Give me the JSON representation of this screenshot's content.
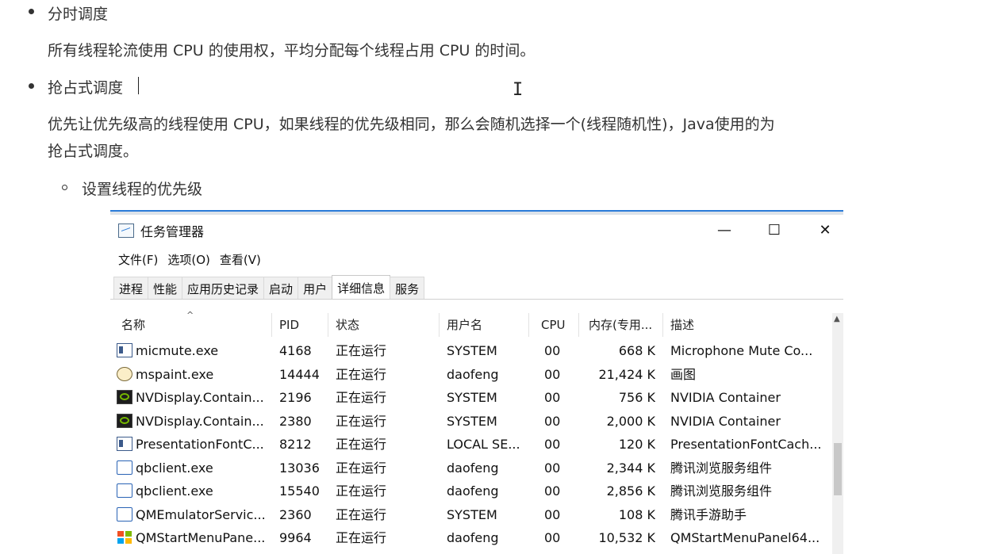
{
  "doc": {
    "bullet1_title": "分时调度",
    "bullet1_body": "所有线程轮流使用 CPU 的使用权，平均分配每个线程占用 CPU 的时间。",
    "bullet2_title": "抢占式调度",
    "bullet2_body_line1": "优先让优先级高的线程使用 CPU，如果线程的优先级相同，那么会随机选择一个(线程随机性)，Java使用的为",
    "bullet2_body_line2": "抢占式调度。",
    "sub_bullet": "设置线程的优先级"
  },
  "taskmgr": {
    "title": "任务管理器",
    "title_icon": "task-manager-icon",
    "window_buttons": {
      "minimize": "—",
      "maximize": "☐",
      "close": "✕"
    },
    "menu": [
      "文件(F)",
      "选项(O)",
      "查看(V)"
    ],
    "tabs": [
      "进程",
      "性能",
      "应用历史记录",
      "启动",
      "用户",
      "详细信息",
      "服务"
    ],
    "active_tab": "详细信息",
    "columns": [
      "名称",
      "PID",
      "状态",
      "用户名",
      "CPU",
      "内存(专用...",
      "描述"
    ],
    "sort_indicator": "^",
    "rows": [
      {
        "icon": "window-app-icon",
        "name": "micmute.exe",
        "pid": "4168",
        "status": "正在运行",
        "user": "SYSTEM",
        "cpu": "00",
        "mem": "668 K",
        "desc": "Microphone Mute Co..."
      },
      {
        "icon": "paint-icon",
        "name": "mspaint.exe",
        "pid": "14444",
        "status": "正在运行",
        "user": "daofeng",
        "cpu": "00",
        "mem": "21,424 K",
        "desc": "画图"
      },
      {
        "icon": "nvidia-icon",
        "name": "NVDisplay.Contain...",
        "pid": "2196",
        "status": "正在运行",
        "user": "SYSTEM",
        "cpu": "00",
        "mem": "756 K",
        "desc": "NVIDIA Container"
      },
      {
        "icon": "nvidia-icon",
        "name": "NVDisplay.Contain...",
        "pid": "2380",
        "status": "正在运行",
        "user": "SYSTEM",
        "cpu": "00",
        "mem": "2,000 K",
        "desc": "NVIDIA Container"
      },
      {
        "icon": "window-app-icon",
        "name": "PresentationFontC...",
        "pid": "8212",
        "status": "正在运行",
        "user": "LOCAL SE...",
        "cpu": "00",
        "mem": "120 K",
        "desc": "PresentationFontCach..."
      },
      {
        "icon": "qb-icon",
        "name": "qbclient.exe",
        "pid": "13036",
        "status": "正在运行",
        "user": "daofeng",
        "cpu": "00",
        "mem": "2,344 K",
        "desc": "腾讯浏览服务组件"
      },
      {
        "icon": "qb-icon",
        "name": "qbclient.exe",
        "pid": "15540",
        "status": "正在运行",
        "user": "daofeng",
        "cpu": "00",
        "mem": "2,856 K",
        "desc": "腾讯浏览服务组件"
      },
      {
        "icon": "qb-icon",
        "name": "QMEmulatorServic...",
        "pid": "2360",
        "status": "正在运行",
        "user": "SYSTEM",
        "cpu": "00",
        "mem": "108 K",
        "desc": "腾讯手游助手"
      },
      {
        "icon": "windows-logo-icon",
        "name": "QMStartMenuPane...",
        "pid": "9964",
        "status": "正在运行",
        "user": "daofeng",
        "cpu": "00",
        "mem": "10,532 K",
        "desc": "QMStartMenuPanel64..."
      }
    ]
  }
}
